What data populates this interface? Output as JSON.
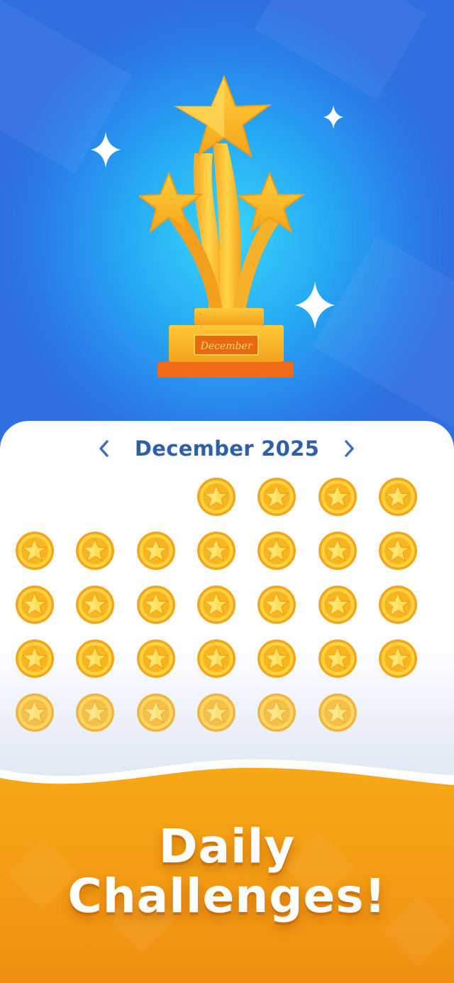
{
  "trophy": {
    "plaque_text": "December",
    "icon": "star-trophy-icon"
  },
  "calendar": {
    "month_label": "December 2025",
    "prev_icon": "chevron-left-icon",
    "next_icon": "chevron-right-icon",
    "first_weekday_index": 3,
    "days_total": 31,
    "completed_days": [
      1,
      2,
      3,
      4,
      5,
      6,
      7,
      8,
      9,
      10,
      11,
      12,
      13,
      14,
      15,
      16,
      17,
      18,
      19,
      20,
      21,
      22,
      23,
      24,
      25,
      26,
      27,
      28,
      29,
      30,
      31
    ],
    "day_icon": "star-coin-icon"
  },
  "footer": {
    "line1": "Daily",
    "line2": "Challenges!"
  },
  "colors": {
    "hero_blue": "#2a7fe9",
    "hero_glow": "#39d6fb",
    "month_text": "#2f5fa6",
    "coin_gold": "#f6b21f",
    "footer_orange": "#f29a12"
  }
}
